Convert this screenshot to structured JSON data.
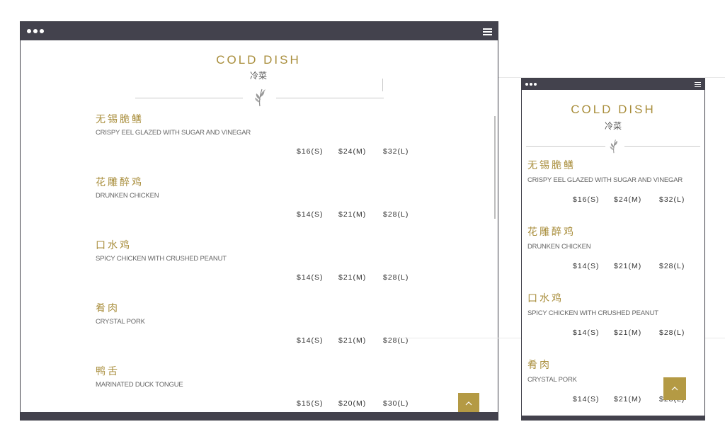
{
  "section": {
    "title": "COLD DISH",
    "subtitle": "冷菜"
  },
  "dishes": [
    {
      "cn": "无锡脆鳝",
      "en": "CRISPY EEL GLAZED WITH SUGAR AND VINEGAR",
      "prices": [
        "$16(S)",
        "$24(M)",
        "$32(L)"
      ]
    },
    {
      "cn": "花雕醉鸡",
      "en": "DRUNKEN CHICKEN",
      "prices": [
        "$14(S)",
        "$21(M)",
        "$28(L)"
      ]
    },
    {
      "cn": "口水鸡",
      "en": "SPICY CHICKEN WITH CRUSHED PEANUT",
      "prices": [
        "$14(S)",
        "$21(M)",
        "$28(L)"
      ]
    },
    {
      "cn": "肴肉",
      "en": "CRYSTAL PORK",
      "prices": [
        "$14(S)",
        "$21(M)",
        "$28(L)"
      ]
    },
    {
      "cn": "鸭舌",
      "en": "MARINATED DUCK TONGUE",
      "prices": [
        "$15(S)",
        "$20(M)",
        "$30(L)"
      ]
    }
  ],
  "icons": {
    "window_dots": "three-dots-icon",
    "menu": "hamburger-menu-icon",
    "divider": "sprig-ornament-icon",
    "back_to_top": "chevron-up-icon"
  },
  "colors": {
    "gold": "#a98e3c",
    "bar": "#43424d",
    "button": "#b49a44"
  }
}
